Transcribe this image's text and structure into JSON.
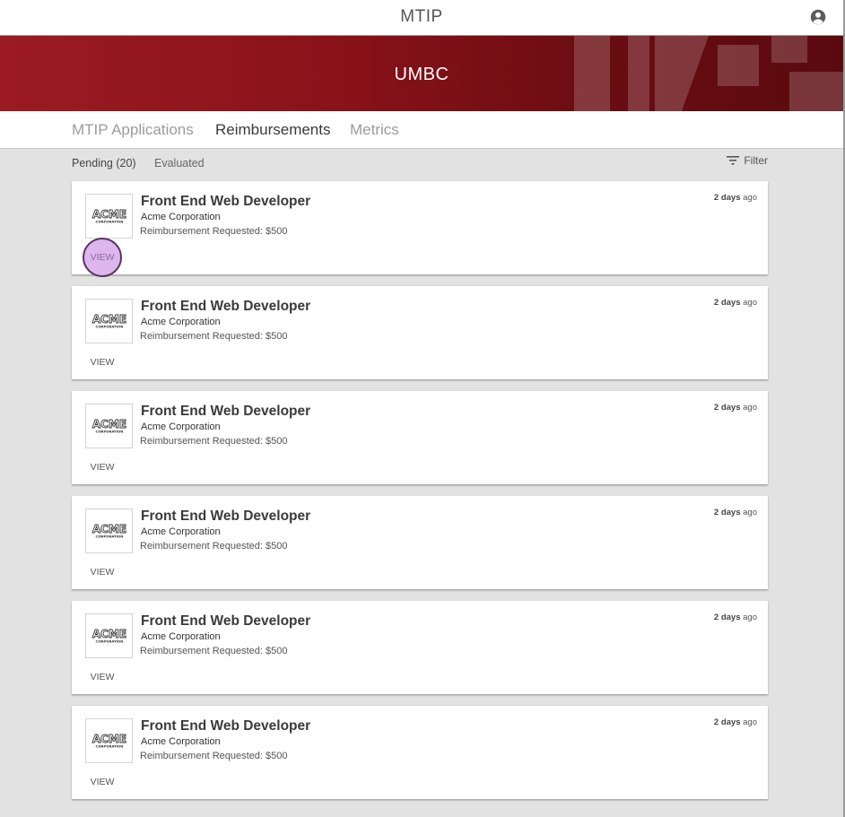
{
  "app": {
    "title": "MTIP"
  },
  "banner": {
    "title": "UMBC"
  },
  "tabs": [
    {
      "label": "MTIP Applications",
      "active": false
    },
    {
      "label": "Reimbursements",
      "active": true
    },
    {
      "label": "Metrics",
      "active": false
    }
  ],
  "subfilters": {
    "pending": "Pending (20)",
    "evaluated": "Evaluated"
  },
  "filter": {
    "label": "Filter"
  },
  "icons": {
    "account": "account-circle-icon",
    "filter": "filter-icon",
    "logo": "acme-logo"
  },
  "colors": {
    "banner": "#8a1219",
    "pressed_view": "#ddb6ee"
  },
  "cards": [
    {
      "title": "Front End Web Developer",
      "company": "Acme Corporation",
      "reimbursement": "Reimbursement Requested: $500",
      "days_num": "2 days",
      "days_suffix": "ago",
      "view": "VIEW"
    },
    {
      "title": "Front End Web Developer",
      "company": "Acme Corporation",
      "reimbursement": "Reimbursement Requested: $500",
      "days_num": "2 days",
      "days_suffix": "ago",
      "view": "VIEW"
    },
    {
      "title": "Front End Web Developer",
      "company": "Acme Corporation",
      "reimbursement": "Reimbursement Requested: $500",
      "days_num": "2 days",
      "days_suffix": "ago",
      "view": "VIEW"
    },
    {
      "title": "Front End Web Developer",
      "company": "Acme Corporation",
      "reimbursement": "Reimbursement Requested: $500",
      "days_num": "2 days",
      "days_suffix": "ago",
      "view": "VIEW"
    },
    {
      "title": "Front End Web Developer",
      "company": "Acme Corporation",
      "reimbursement": "Reimbursement Requested: $500",
      "days_num": "2 days",
      "days_suffix": "ago",
      "view": "VIEW"
    },
    {
      "title": "Front End Web Developer",
      "company": "Acme Corporation",
      "reimbursement": "Reimbursement Requested: $500",
      "days_num": "2 days",
      "days_suffix": "ago",
      "view": "VIEW"
    }
  ]
}
